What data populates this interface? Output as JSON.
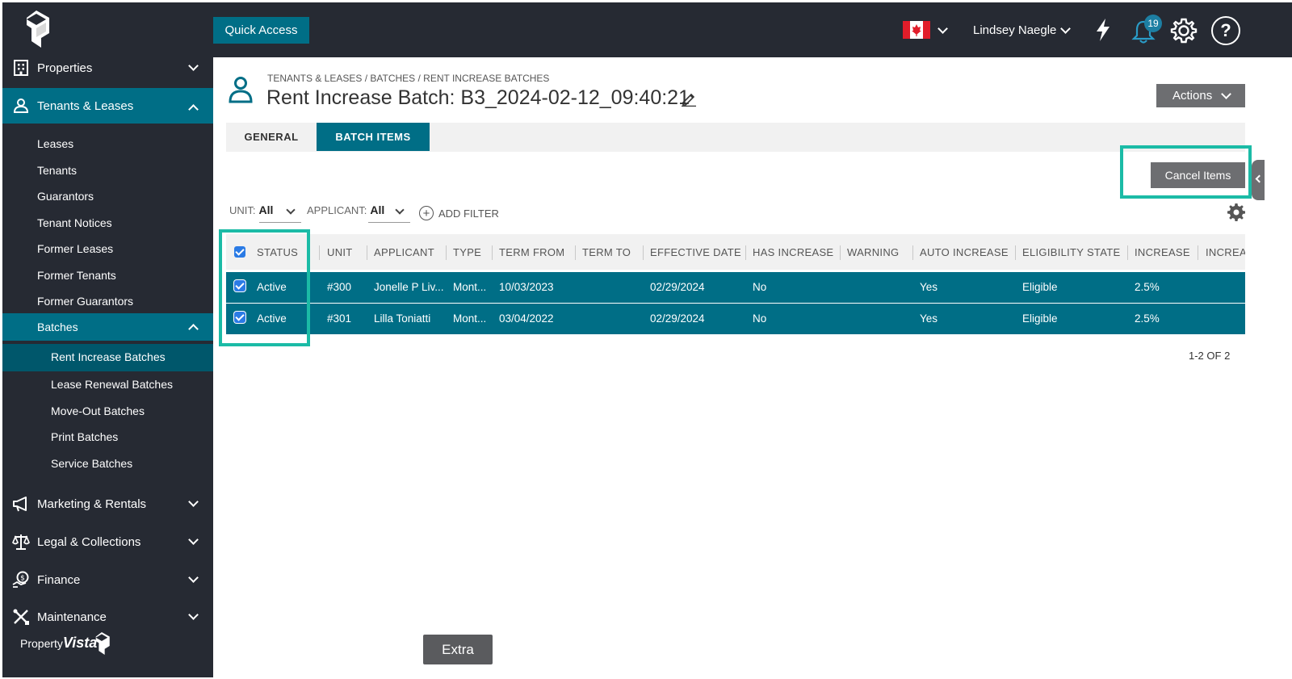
{
  "topbar": {
    "quick_access": "Quick Access",
    "user_name": "Lindsey Naegle",
    "notification_count": "19",
    "help_glyph": "?"
  },
  "sidebar": {
    "main_items": [
      {
        "label": "Properties",
        "icon": "building-icon"
      },
      {
        "label": "Tenants & Leases",
        "icon": "person-icon"
      },
      {
        "label": "Marketing & Rentals",
        "icon": "megaphone-icon"
      },
      {
        "label": "Legal & Collections",
        "icon": "scales-icon"
      },
      {
        "label": "Finance",
        "icon": "money-icon"
      },
      {
        "label": "Maintenance",
        "icon": "tools-icon"
      }
    ],
    "tenant_sub_items": [
      "Leases",
      "Tenants",
      "Guarantors",
      "Tenant Notices",
      "Former Leases",
      "Former Tenants",
      "Former Guarantors"
    ],
    "batches_label": "Batches",
    "batch_sub_items": [
      "Rent Increase Batches",
      "Lease Renewal Batches",
      "Move-Out Batches",
      "Print Batches",
      "Service Batches"
    ],
    "brand_prefix": "Property",
    "brand_name": "Vista"
  },
  "main": {
    "breadcrumb": "TENANTS & LEASES / BATCHES / RENT INCREASE BATCHES",
    "title": "Rent Increase Batch: B3_2024-02-12_09:40:21",
    "actions_label": "Actions",
    "tabs": [
      "GENERAL",
      "BATCH ITEMS"
    ],
    "cancel_items_label": "Cancel Items",
    "filters": {
      "unit_label": "UNIT:",
      "unit_value": "All",
      "applicant_label": "APPLICANT:",
      "applicant_value": "All",
      "add_filter": "ADD FILTER"
    },
    "columns": [
      "STATUS",
      "UNIT",
      "APPLICANT",
      "TYPE",
      "TERM FROM",
      "TERM TO",
      "EFFECTIVE DATE",
      "HAS INCREASE",
      "WARNING",
      "AUTO INCREASE",
      "ELIGIBILITY STATE",
      "INCREASE",
      "INCREAS"
    ],
    "rows": [
      {
        "status": "Active",
        "unit": "#300",
        "applicant": "Jonelle P Liv...",
        "type": "Mont...",
        "term_from": "10/03/2023",
        "term_to": "",
        "effective_date": "02/29/2024",
        "has_increase": "No",
        "warning": "",
        "auto_increase": "Yes",
        "eligibility_state": "Eligible",
        "increase": "2.5%"
      },
      {
        "status": "Active",
        "unit": "#301",
        "applicant": "Lilla Toniatti",
        "type": "Mont...",
        "term_from": "03/04/2022",
        "term_to": "",
        "effective_date": "02/29/2024",
        "has_increase": "No",
        "warning": "",
        "auto_increase": "Yes",
        "eligibility_state": "Eligible",
        "increase": "2.5%"
      }
    ],
    "pager": "1-2 OF 2",
    "extra_label": "Extra"
  },
  "colors": {
    "dark_bg": "#262a33",
    "teal": "#006e86",
    "highlight": "#1bbba6",
    "button_gray": "#6d6e71"
  }
}
